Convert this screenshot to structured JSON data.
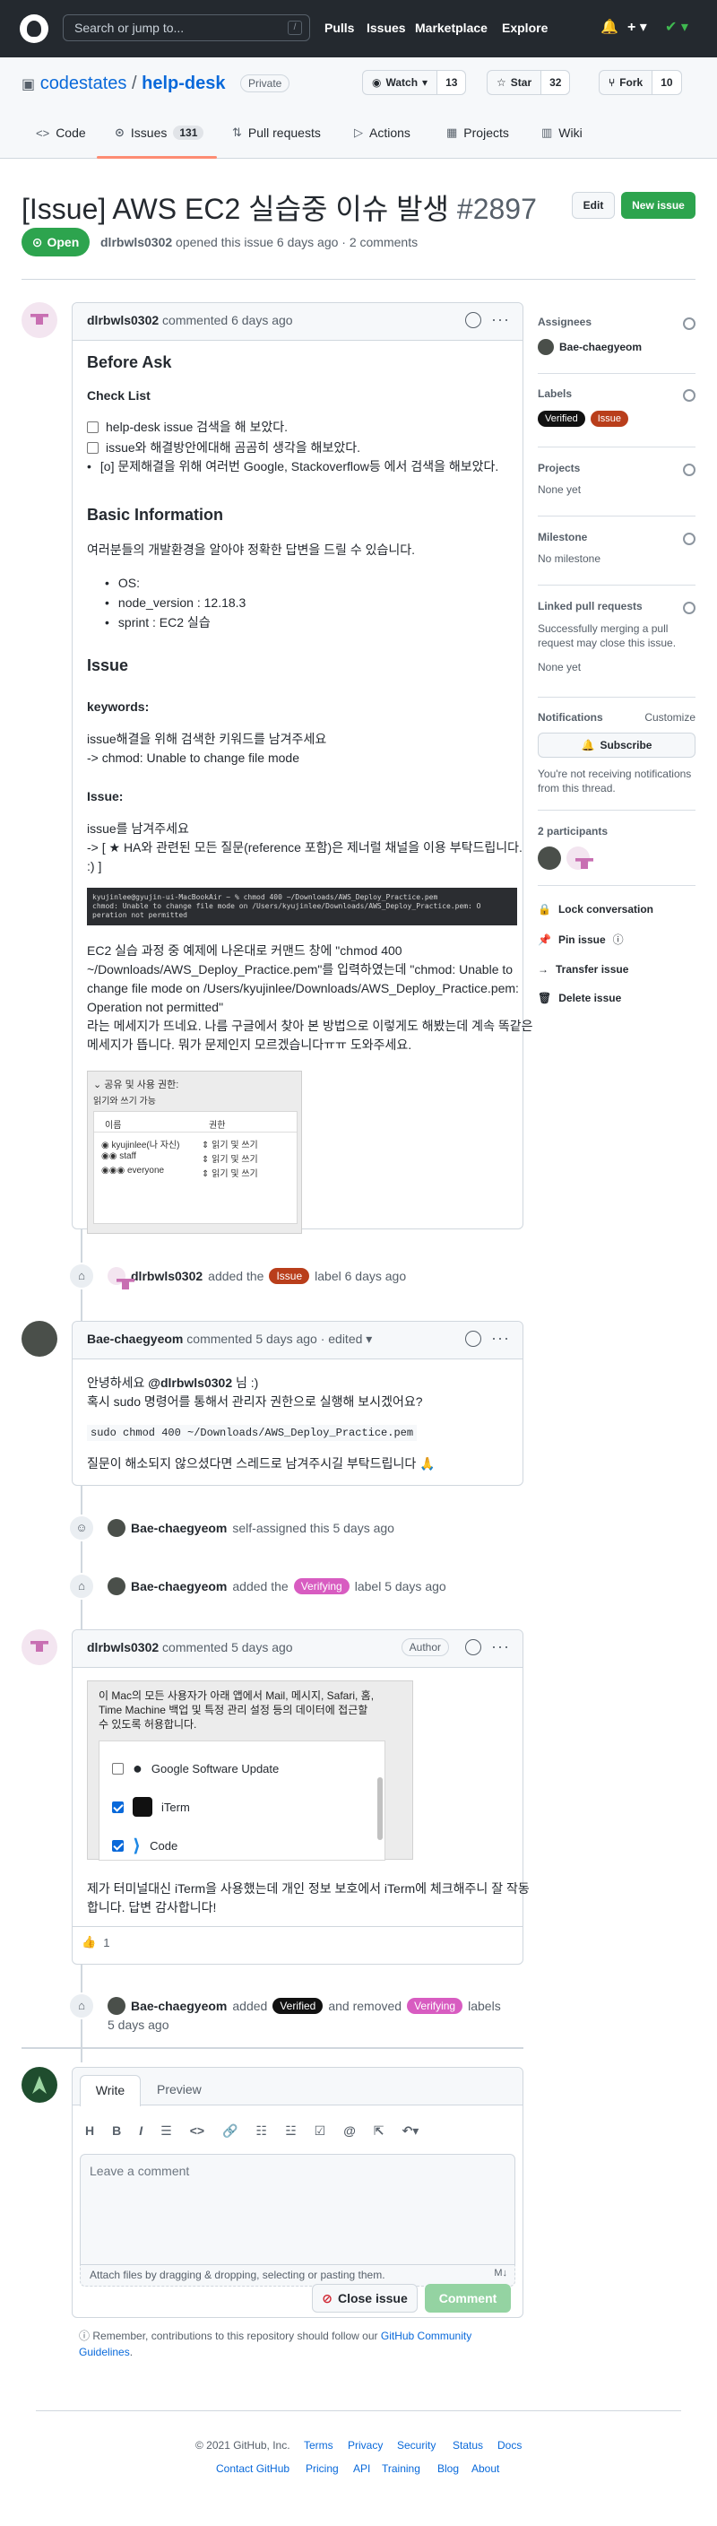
{
  "header": {
    "search_placeholder": "Search or jump to...",
    "slash": "/",
    "nav": [
      "Pulls",
      "Issues",
      "Marketplace",
      "Explore"
    ]
  },
  "repo": {
    "owner": "codestates",
    "sep": "/",
    "name": "help-desk",
    "visibility": "Private",
    "watch_label": "Watch",
    "watch_count": "13",
    "star_label": "Star",
    "star_count": "32",
    "fork_label": "Fork",
    "fork_count": "10",
    "tabs": {
      "code": "Code",
      "issues": "Issues",
      "issues_count": "131",
      "pulls": "Pull requests",
      "actions": "Actions",
      "projects": "Projects",
      "wiki": "Wiki"
    }
  },
  "issue": {
    "title": "[Issue] AWS EC2 실습중 이슈 발생",
    "number": "#2897",
    "edit_label": "Edit",
    "new_label": "New issue",
    "state": "Open",
    "author": "dlrbwls0302",
    "meta_rest": "opened this issue 6 days ago · 2 comments"
  },
  "comment1": {
    "author": "dlrbwls0302",
    "time": "commented 6 days ago",
    "h_before": "Before Ask",
    "h_checklist": "Check List",
    "task1": "help-desk issue 검색을 해 보았다.",
    "task2": "issue와 해결방안에대해 곰곰히 생각을 해보았다.",
    "task3": "[o] 문제해결을 위해 여러번 Google, Stackoverflow등 에서 검색을 해보았다.",
    "h_basic": "Basic Information",
    "basic_desc": "여러분들의 개발환경을 알아야 정확한 답변을 드릴 수 있습니다.",
    "os": "OS:",
    "node": "node_version : 12.18.3",
    "sprint": "sprint : EC2 실습",
    "h_issue": "Issue",
    "h_keywords": "keywords:",
    "kw1": "issue해결을 위해 검색한 키워드를 남겨주세요",
    "kw2": "-> chmod: Unable to change file mode",
    "h_issue2": "Issue:",
    "is1": "issue를 남겨주세요",
    "is2": "-> [ ★ HA와 관련된 모든 질문(reference 포함)은 제너럴 채널을 이용 부탁드립니다.",
    "is3": ":) ]",
    "term1": "kyujinlee@gyujin-ui-MacBookAir ~ % chmod 400 ~/Downloads/AWS_Deploy_Practice.pem",
    "term2": "chmod: Unable to change file mode on /Users/kyujinlee/Downloads/AWS_Deploy_Practice.pem: O",
    "term3": "peration not permitted",
    "desc1": "EC2 실습 과정 중 예제에 나온대로 커맨드 창에 \"chmod 400",
    "desc2": "~/Downloads/AWS_Deploy_Practice.pem\"를 입력하였는데 \"chmod: Unable to",
    "desc3": "change file mode on /Users/kyujinlee/Downloads/AWS_Deploy_Practice.pem:",
    "desc4": "Operation not permitted\"",
    "desc5": "라는 메세지가 뜨네요. 나름 구글에서 찾아 본 방법으로 이렇게도 해봤는데 계속 똑같은",
    "desc6": "메세지가 뜹니다. 뭐가 문제인지 모르겠습니다ㅠㅠ 도와주세요.",
    "finder_title": "공유 및 사용 권한:",
    "finder_sub": "읽기와 쓰기 가능",
    "finder_col1": "이름",
    "finder_col2": "권한",
    "finder_rows": [
      {
        "name": "kyujinlee(나 자신)",
        "perm": "읽기 및 쓰기"
      },
      {
        "name": "staff",
        "perm": "읽기 및 쓰기"
      },
      {
        "name": "everyone",
        "perm": "읽기 및 쓰기"
      }
    ]
  },
  "event1": {
    "author": "dlrbwls0302",
    "pre": "added the",
    "label": "Issue",
    "post": "label 6 days ago"
  },
  "comment2": {
    "author": "Bae-chaegyeom",
    "time": "commented 5 days ago · edited",
    "l1": "안녕하세요",
    "mention": "@dlrbwls0302",
    "l1b": "님 :)",
    "l2": "혹시 sudo 명령어를 통해서 관리자 권한으로 실행해 보시겠어요?",
    "code": "sudo chmod 400 ~/Downloads/AWS_Deploy_Practice.pem",
    "l3": "질문이 해소되지 않으셨다면 스레드로 남겨주시길 부탁드립니다 🙏"
  },
  "event2": {
    "author": "Bae-chaegyeom",
    "text": "self-assigned this 5 days ago"
  },
  "event3": {
    "author": "Bae-chaegyeom",
    "pre": "added the",
    "label": "Verifying",
    "post": "label 5 days ago"
  },
  "comment3": {
    "author": "dlrbwls0302",
    "time": "commented 5 days ago",
    "role": "Author",
    "mac1": "이 Mac의 모든 사용자가 아래 앱에서 Mail, 메시지, Safari, 홈,",
    "mac2": "Time Machine 백업 및 특정 관리 설정 등의 데이터에 접근할",
    "mac3": "수 있도록 허용합니다.",
    "apps": [
      "Google Software Update",
      "iTerm",
      "Code"
    ],
    "text1": "제가 터미널대신 iTerm을 사용했는데 개인 정보 보호에서 iTerm에 체크해주니 잘 작동",
    "text2": "합니다. 답변 감사합니다!",
    "reaction": "👍",
    "reaction_count": "1"
  },
  "event4": {
    "author": "Bae-chaegyeom",
    "pre": "added",
    "label_a": "Verified",
    "mid": "and removed",
    "label_b": "Verifying",
    "post": "labels",
    "time": "5 days ago"
  },
  "composer": {
    "tab_write": "Write",
    "tab_preview": "Preview",
    "placeholder": "Leave a comment",
    "attach": "Attach files by dragging & dropping, selecting or pasting them.",
    "close_label": "Close issue",
    "comment_label": "Comment",
    "remember_pre": "Remember, contributions to this repository should follow our",
    "remember_link": "GitHub Community",
    "remember_link2": "Guidelines",
    "remember_dot": "."
  },
  "sidebar": {
    "assignees": "Assignees",
    "assignee": "Bae-chaegyeom",
    "labels": "Labels",
    "label_verified": "Verified",
    "label_issue": "Issue",
    "projects": "Projects",
    "projects_val": "None yet",
    "milestone": "Milestone",
    "milestone_val": "No milestone",
    "linked": "Linked pull requests",
    "linked_desc1": "Successfully merging a pull",
    "linked_desc2": "request may close this issue.",
    "linked_val": "None yet",
    "notifications": "Notifications",
    "customize": "Customize",
    "subscribe": "Subscribe",
    "notif_desc1": "You're not receiving notifications",
    "notif_desc2": "from this thread.",
    "participants": "2 participants",
    "lock": "Lock conversation",
    "pin": "Pin issue",
    "transfer": "Transfer issue",
    "delete": "Delete issue"
  },
  "footer": {
    "copyright": "© 2021 GitHub, Inc.",
    "row1": [
      "Terms",
      "Privacy",
      "Security",
      "Status",
      "Docs"
    ],
    "row2": [
      "Contact GitHub",
      "Pricing",
      "API",
      "Training",
      "Blog",
      "About"
    ]
  },
  "colors": {
    "green": "#2da44e",
    "label_issue": "#b93e1b",
    "label_verifying": "#d85cc1",
    "label_verified": "#111111",
    "link": "#0969da"
  }
}
